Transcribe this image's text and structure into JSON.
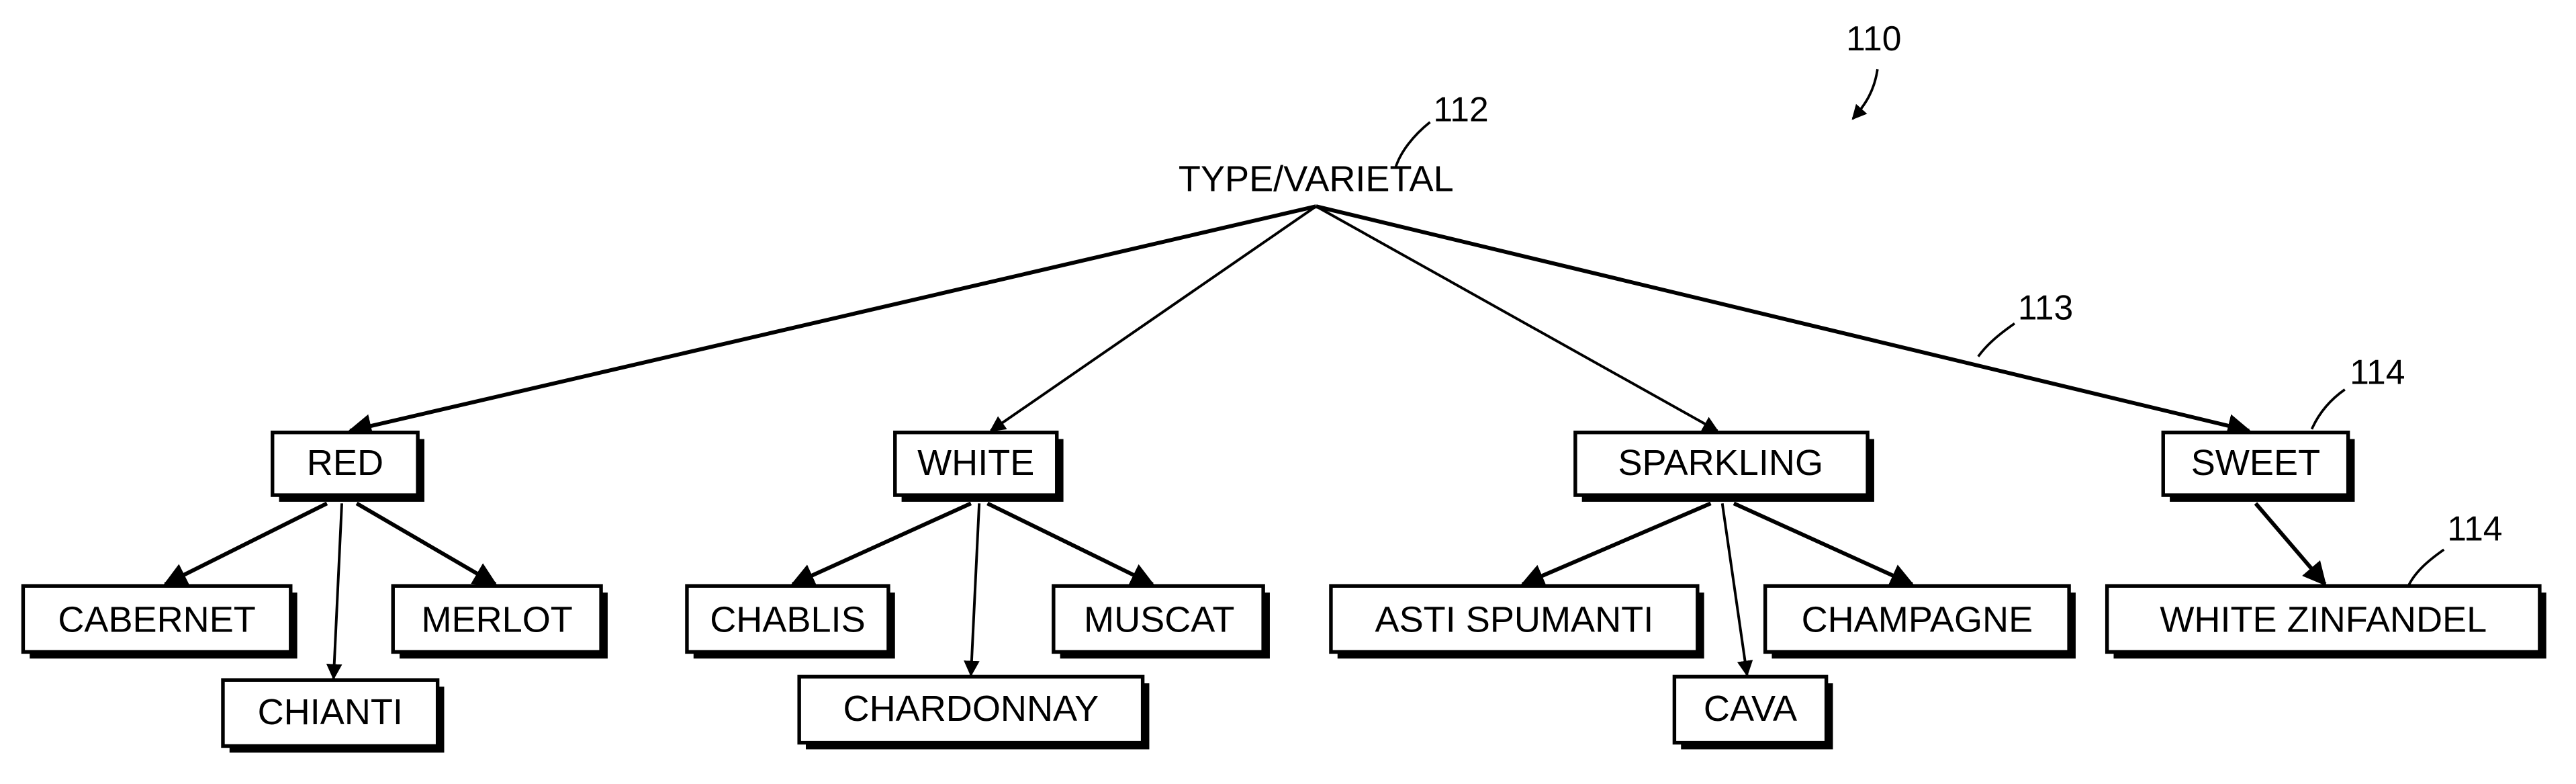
{
  "figure": {
    "ref_label": "110",
    "root": {
      "label": "TYPE/VARIETAL",
      "ref": "112"
    },
    "edge_ref": "113",
    "node_ref": "114",
    "categories": [
      {
        "id": "red",
        "label": "RED",
        "children": [
          "CABERNET",
          "CHIANTI",
          "MERLOT"
        ]
      },
      {
        "id": "white",
        "label": "WHITE",
        "children": [
          "CHABLIS",
          "CHARDONNAY",
          "MUSCAT"
        ]
      },
      {
        "id": "sparkling",
        "label": "SPARKLING",
        "children": [
          "ASTI SPUMANTI",
          "CAVA",
          "CHAMPAGNE"
        ]
      },
      {
        "id": "sweet",
        "label": "SWEET",
        "children": [
          "WHITE ZINFANDEL"
        ]
      }
    ]
  }
}
